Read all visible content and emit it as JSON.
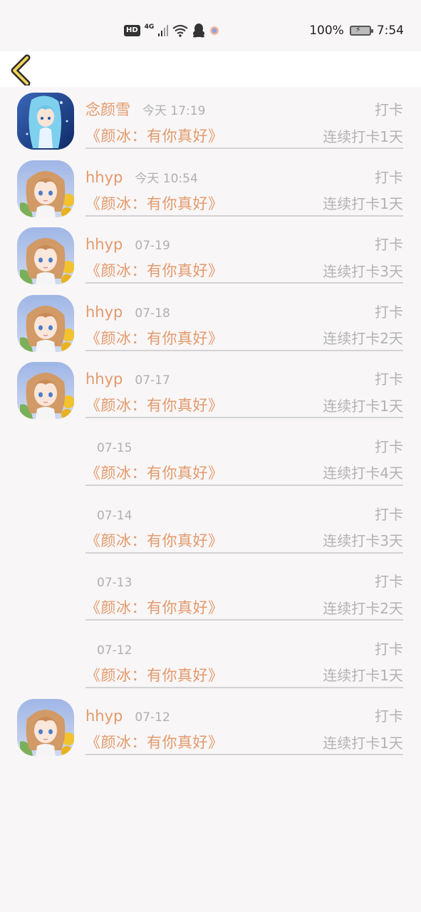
{
  "status_bar": {
    "hd": "HD",
    "network": "4G",
    "battery": "100%",
    "time": "7:54",
    "icons": [
      "signal-icon",
      "wifi-icon",
      "qq-icon",
      "app-icon",
      "battery-icon"
    ]
  },
  "nav": {
    "back_icon": "chevron-left-icon"
  },
  "entries": [
    {
      "username": "念颜雪",
      "time": "今天 17:19",
      "action": "打卡",
      "book": "《颜冰：有你真好》",
      "streak": "连续打卡1天",
      "avatar": "blue-hair-avatar"
    },
    {
      "username": "hhyp",
      "time": "今天 10:54",
      "action": "打卡",
      "book": "《颜冰：有你真好》",
      "streak": "连续打卡1天",
      "avatar": "brown-hair-avatar"
    },
    {
      "username": "hhyp",
      "time": "07-19",
      "action": "打卡",
      "book": "《颜冰：有你真好》",
      "streak": "连续打卡3天",
      "avatar": "brown-hair-avatar"
    },
    {
      "username": "hhyp",
      "time": "07-18",
      "action": "打卡",
      "book": "《颜冰：有你真好》",
      "streak": "连续打卡2天",
      "avatar": "brown-hair-avatar"
    },
    {
      "username": "hhyp",
      "time": "07-17",
      "action": "打卡",
      "book": "《颜冰：有你真好》",
      "streak": "连续打卡1天",
      "avatar": "brown-hair-avatar"
    },
    {
      "username": "",
      "time": "07-15",
      "action": "打卡",
      "book": "《颜冰：有你真好》",
      "streak": "连续打卡4天",
      "avatar": ""
    },
    {
      "username": "",
      "time": "07-14",
      "action": "打卡",
      "book": "《颜冰：有你真好》",
      "streak": "连续打卡3天",
      "avatar": ""
    },
    {
      "username": "",
      "time": "07-13",
      "action": "打卡",
      "book": "《颜冰：有你真好》",
      "streak": "连续打卡2天",
      "avatar": ""
    },
    {
      "username": "",
      "time": "07-12",
      "action": "打卡",
      "book": "《颜冰：有你真好》",
      "streak": "连续打卡1天",
      "avatar": ""
    },
    {
      "username": "hhyp",
      "time": "07-12",
      "action": "打卡",
      "book": "《颜冰：有你真好》",
      "streak": "连续打卡1天",
      "avatar": "brown-hair-avatar"
    }
  ],
  "colors": {
    "accent": "#e39a6c",
    "muted": "#b3b3b3",
    "background": "#f8f6f7",
    "back_arrow": "#f2d55a"
  }
}
